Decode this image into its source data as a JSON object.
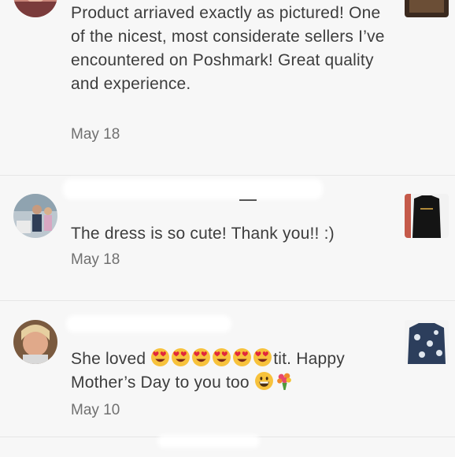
{
  "reviews": [
    {
      "text": "Product arriaved exactly as pictured! One of the nicest, most considerate sellers I’ve encountered on Poshmark! Great quality and experience.",
      "date": "May 18"
    },
    {
      "text": "The dress is so cute! Thank you!! :)",
      "date": "May 18"
    },
    {
      "text_part1": "She loved",
      "text_part2": "tit. Happy",
      "text_part3": "Mother’s Day to you too",
      "emojis_row1": [
        "heart-eyes-emoji",
        "heart-eyes-emoji",
        "heart-eyes-emoji",
        "heart-eyes-emoji",
        "heart-eyes-emoji",
        "heart-eyes-emoji"
      ],
      "emojis_row2": [
        "grinning-emoji",
        "bouquet-emoji"
      ],
      "date": "May 10"
    }
  ],
  "colors": {
    "background": "#f7f7f7",
    "text": "#3d3d3d",
    "date": "#707070",
    "divider": "#e6e6e6"
  }
}
